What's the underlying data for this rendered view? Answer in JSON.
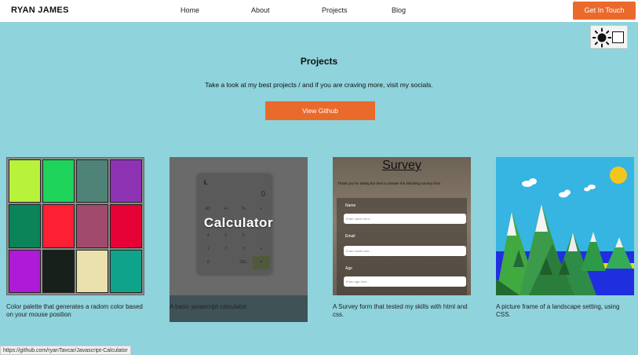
{
  "navbar": {
    "brand": "RYAN JAMES",
    "links": [
      "Home",
      "About",
      "Projects",
      "Blog"
    ],
    "cta": "Get In Touch"
  },
  "theme_toggle": {
    "icon": "sun-icon"
  },
  "projects": {
    "title": "Projects",
    "subtitle": "Take a look at my best projects / and if you are craving more, visit my socials.",
    "button": "View Github",
    "cards": [
      {
        "caption": "Color palette that generates a radom color based on your mouse position",
        "colors": [
          "#b9f23a",
          "#1fd45a",
          "#4f8378",
          "#8d33b4",
          "#0a8458",
          "#fd1f34",
          "#a24a6c",
          "#e60136",
          "#ae1ad8",
          "#17201a",
          "#ebe1ac",
          "#10a38c"
        ]
      },
      {
        "caption": "A basic javascript calculator.",
        "title": "Calculator",
        "display": "0",
        "keys": [
          "AC",
          "+/-",
          "%",
          "÷",
          "7",
          "8",
          "9",
          "×",
          "4",
          "5",
          "6",
          "−",
          "1",
          "2",
          "3",
          "+",
          "0",
          "",
          "DEL",
          "="
        ]
      },
      {
        "caption": "A Survey form that tested my skills with html and css.",
        "title": "Survey",
        "description": "Thank you for taking the time to answer the following survery form.",
        "fields": [
          {
            "label": "Name",
            "placeholder": "Enter name here..."
          },
          {
            "label": "Email",
            "placeholder": "Enter email here..."
          },
          {
            "label": "Age",
            "placeholder": "Enter age here..."
          }
        ]
      },
      {
        "caption": "A picture frame of a landscape setting, using CSS."
      }
    ]
  },
  "status_bar": {
    "url": "https://github.com/ryanTavcar/Javascript-Calculator"
  }
}
